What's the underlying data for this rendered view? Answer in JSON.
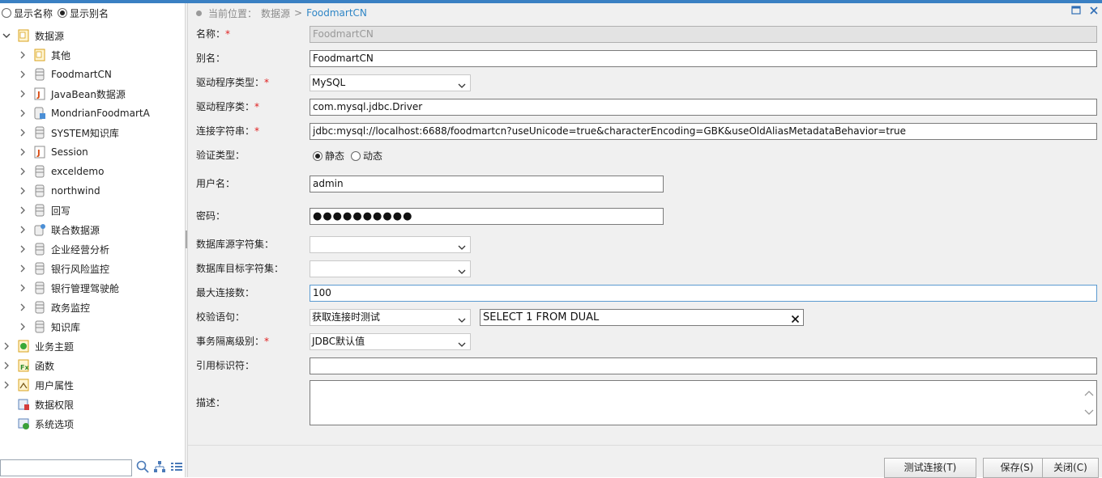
{
  "left": {
    "display_options": {
      "show_name": "显示名称",
      "show_alias": "显示别名"
    },
    "tree": {
      "root": "数据源",
      "children": [
        "其他",
        "FoodmartCN",
        "JavaBean数据源",
        "MondrianFoodmartA",
        "SYSTEM知识库",
        "Session",
        "exceldemo",
        "northwind",
        "回写",
        "联合数据源",
        "企业经营分析",
        "银行风险监控",
        "银行管理驾驶舱",
        "政务监控",
        "知识库"
      ],
      "others": [
        "业务主题",
        "函数",
        "用户属性",
        "数据权限",
        "系统选项"
      ]
    },
    "search": {
      "value": ""
    }
  },
  "breadcrumb": {
    "prefix": "当前位置：",
    "parent": "数据源",
    "separator": ">",
    "current": "FoodmartCN"
  },
  "form": {
    "name_label": "名称：",
    "name_value": "FoodmartCN",
    "alias_label": "别名：",
    "alias_value": "FoodmartCN",
    "driver_type_label": "驱动程序类型：",
    "driver_type_value": "MySQL",
    "driver_class_label": "驱动程序类：",
    "driver_class_value": "com.mysql.jdbc.Driver",
    "conn_label": "连接字符串：",
    "conn_value": "jdbc:mysql://localhost:6688/foodmartcn?useUnicode=true&characterEncoding=GBK&useOldAliasMetadataBehavior=true",
    "auth_label": "验证类型：",
    "auth_static": "静态",
    "auth_dynamic": "动态",
    "user_label": "用户名：",
    "user_value": "admin",
    "password_label": "密码：",
    "password_value": "●●●●●●●●●●",
    "src_charset_label": "数据库源字符集：",
    "src_charset_value": "",
    "dst_charset_label": "数据库目标字符集：",
    "dst_charset_value": "",
    "maxconn_label": "最大连接数：",
    "maxconn_value": "100",
    "check_label": "校验语句：",
    "check_mode_value": "获取连接时测试",
    "check_sql_value": "SELECT 1 FROM DUAL",
    "isolation_label": "事务隔离级别：",
    "isolation_value": "JDBC默认值",
    "quote_label": "引用标识符：",
    "quote_value": "",
    "desc_label": "描述：",
    "desc_value": "",
    "required_mark": "*"
  },
  "buttons": {
    "test": "测试连接(T)",
    "save": "保存(S)",
    "close": "关闭(C)"
  },
  "colors": {
    "accent": "#2f86c6",
    "top_bar": "#3a80c3",
    "required": "#e02020"
  }
}
